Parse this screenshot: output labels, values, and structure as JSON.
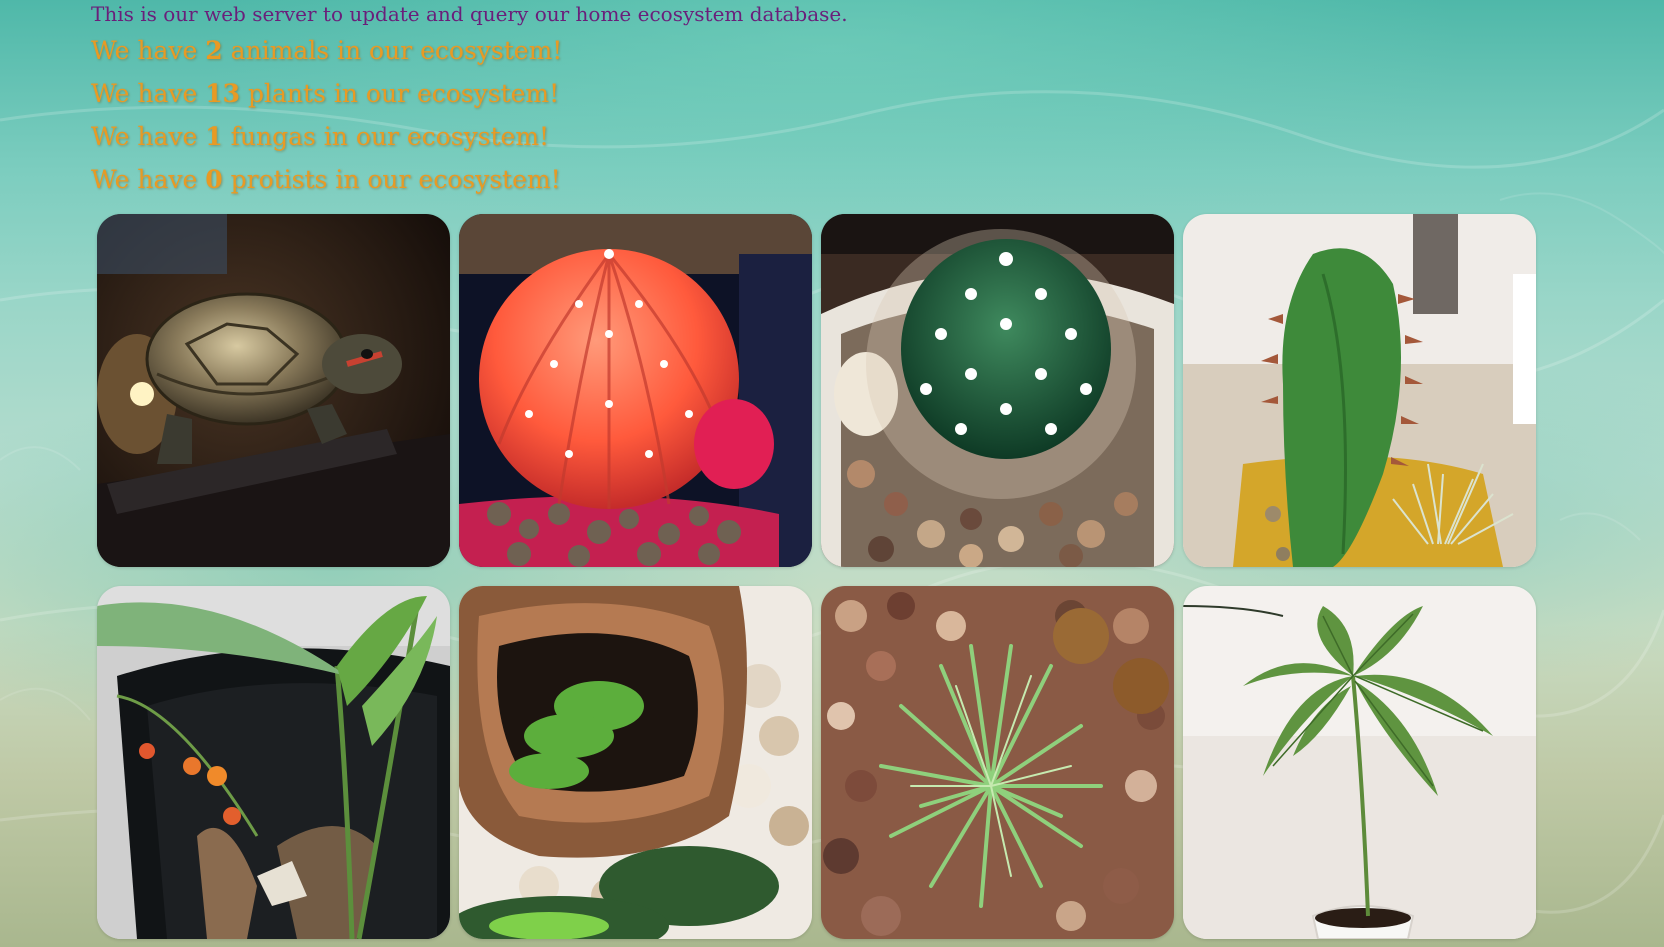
{
  "intro_text": "This is our web server to update and query our home ecosystem database.",
  "counts": [
    {
      "prefix": "We have ",
      "number": "2",
      "suffix": " animals in our ecosystem!"
    },
    {
      "prefix": "We have ",
      "number": "13",
      "suffix": " plants in our ecosystem!"
    },
    {
      "prefix": "We have ",
      "number": "1",
      "suffix": " fungas in our ecosystem!"
    },
    {
      "prefix": "We have ",
      "number": "0",
      "suffix": " protists in our ecosystem!"
    }
  ],
  "gallery": [
    {
      "subject": "turtle-photo"
    },
    {
      "subject": "red-cactus-photo"
    },
    {
      "subject": "green-barrel-cactus-photo"
    },
    {
      "subject": "succulent-photo"
    },
    {
      "subject": "plant-with-berries-photo"
    },
    {
      "subject": "moss-terrarium-photo"
    },
    {
      "subject": "air-plant-photo"
    },
    {
      "subject": "mango-seedling-photo"
    }
  ],
  "colors": {
    "intro_text": "#6a1f7a",
    "count_text": "#e89a24"
  }
}
